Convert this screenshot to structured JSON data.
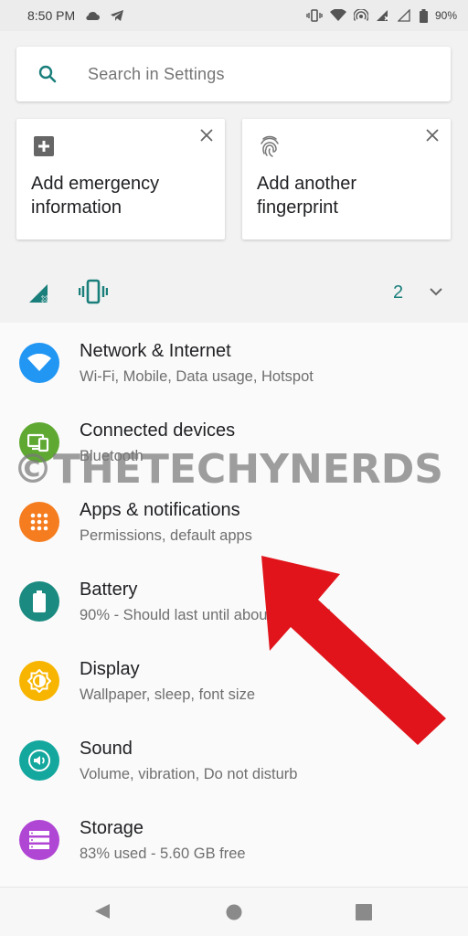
{
  "status_bar": {
    "time": "8:50 PM",
    "battery": "90%",
    "icons": [
      "cloud-icon",
      "telegram-icon",
      "vibrate-icon",
      "wifi-icon",
      "hotspot-icon",
      "signal-x-icon",
      "signal-icon",
      "battery-icon"
    ]
  },
  "search": {
    "placeholder": "Search in Settings",
    "icon": "search-icon"
  },
  "suggestions": [
    {
      "title": "Add emergency information",
      "icon": "add-box-icon"
    },
    {
      "title": "Add another fingerprint",
      "icon": "fingerprint-icon"
    }
  ],
  "conditions": {
    "count": "2",
    "icons": [
      "no-signal-icon",
      "vibrate-icon"
    ]
  },
  "settings": [
    {
      "title": "Network & Internet",
      "subtitle": "Wi-Fi, Mobile, Data usage, Hotspot",
      "icon": "wifi-icon",
      "color": "#2196f3"
    },
    {
      "title": "Connected devices",
      "subtitle": "Bluetooth",
      "icon": "devices-icon",
      "color": "#5fa832"
    },
    {
      "title": "Apps & notifications",
      "subtitle": "Permissions, default apps",
      "icon": "apps-icon",
      "color": "#f57c1f"
    },
    {
      "title": "Battery",
      "subtitle": "90% - Should last until about 7:00 AM",
      "icon": "battery-icon",
      "color": "#1b8a80"
    },
    {
      "title": "Display",
      "subtitle": "Wallpaper, sleep, font size",
      "icon": "brightness-icon",
      "color": "#f7b500"
    },
    {
      "title": "Sound",
      "subtitle": "Volume, vibration, Do not disturb",
      "icon": "volume-icon",
      "color": "#14a79e"
    },
    {
      "title": "Storage",
      "subtitle": "83% used - 5.60 GB free",
      "icon": "storage-icon",
      "color": "#b046d4"
    }
  ],
  "watermark": "©THETECHYNERDS",
  "colors": {
    "accent": "#1a7f7b",
    "arrow": "#e0141a"
  }
}
